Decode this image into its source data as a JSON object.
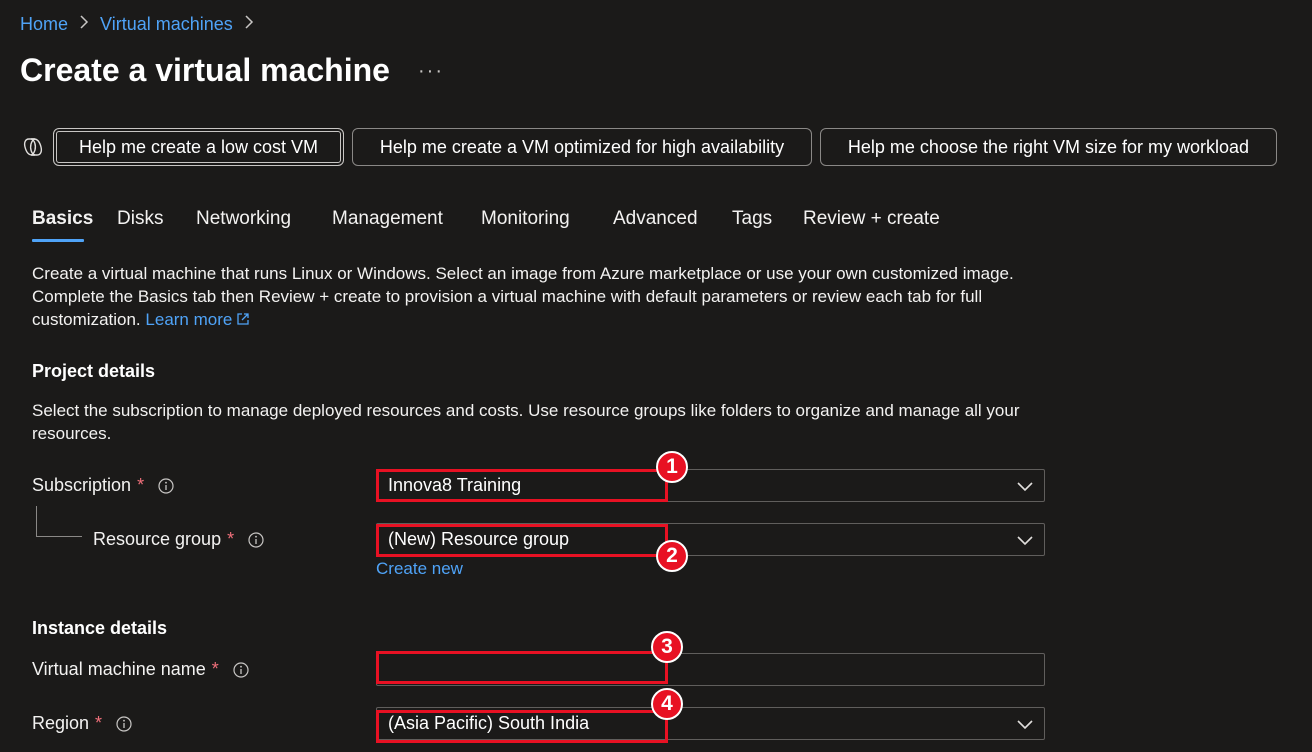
{
  "breadcrumb": {
    "home": "Home",
    "current": "Virtual machines"
  },
  "page": {
    "title": "Create a virtual machine",
    "more": "···"
  },
  "prompts": [
    "Help me create a low cost VM",
    "Help me create a VM optimized for high availability",
    "Help me choose the right VM size for my workload"
  ],
  "tabs": [
    "Basics",
    "Disks",
    "Networking",
    "Management",
    "Monitoring",
    "Advanced",
    "Tags",
    "Review + create"
  ],
  "intro": {
    "text": "Create a virtual machine that runs Linux or Windows. Select an image from Azure marketplace or use your own customized image. Complete the Basics tab then Review + create to provision a virtual machine with default parameters or review each tab for full customization.",
    "link": "Learn more"
  },
  "project": {
    "title": "Project details",
    "description": "Select the subscription to manage deployed resources and costs. Use resource groups like folders to organize and manage all your resources.",
    "subscription_label": "Subscription",
    "subscription_value": "Innova8 Training",
    "resource_group_label": "Resource group",
    "resource_group_value": "(New) Resource group",
    "create_new": "Create new"
  },
  "instance": {
    "title": "Instance details",
    "vm_name_label": "Virtual machine name",
    "vm_name_value": "",
    "region_label": "Region",
    "region_value": "(Asia Pacific) South India"
  },
  "required_mark": "*",
  "annotations": [
    "1",
    "2",
    "3",
    "4"
  ],
  "colors": {
    "link": "#4fa3f7",
    "annotation": "#e81123",
    "background": "#1b1a19",
    "required": "#f1707b"
  }
}
